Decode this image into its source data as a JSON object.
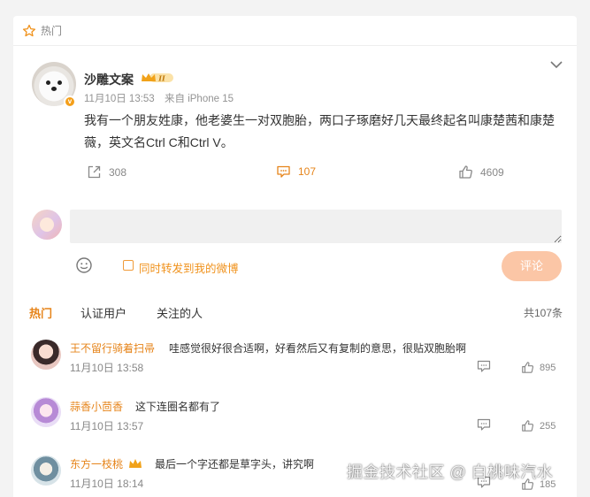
{
  "section": {
    "label": "热门"
  },
  "post": {
    "author": "沙雕文案",
    "level": "II",
    "time": "11月10日 13:53",
    "source": "来自 iPhone 15",
    "text": "我有一个朋友姓康，他老婆生一对双胞胎，两口子琢磨好几天最终起名叫康楚茜和康楚薇，英文名Ctrl C和Ctrl V。",
    "reposts": "308",
    "comments": "107",
    "likes": "4609"
  },
  "composer": {
    "placeholder": "",
    "repost_label": "同时转发到我的微博",
    "submit_label": "评论"
  },
  "tabs": [
    {
      "label": "热门"
    },
    {
      "label": "认证用户"
    },
    {
      "label": "关注的人"
    }
  ],
  "total": "共107条",
  "comments": [
    {
      "name": "王不留行骑着扫帚",
      "text": "哇感觉很好很合适啊，好看然后又有复制的意思，很贴双胞胎啊",
      "time": "11月10日 13:58",
      "likes": "895"
    },
    {
      "name": "蒜香小茴香",
      "text": "这下连圈名都有了",
      "time": "11月10日 13:57",
      "likes": "255"
    },
    {
      "name": "东方一枝桃",
      "text": "最后一个字还都是草字头，讲究啊",
      "time": "11月10日 18:14",
      "likes": "185"
    }
  ],
  "watermark": "掘金技术社区 @ 白桃味汽水",
  "colors": {
    "accent": "#e6841a",
    "submit": "#fbc6a6"
  }
}
